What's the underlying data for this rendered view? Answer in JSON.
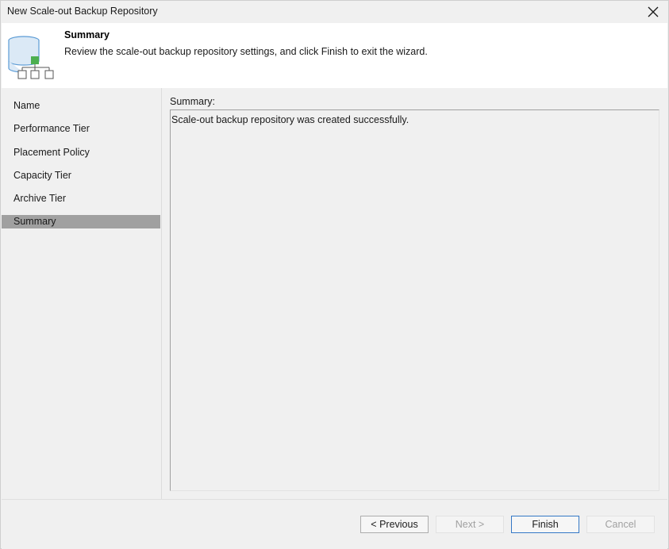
{
  "window": {
    "title": "New Scale-out Backup Repository"
  },
  "header": {
    "title": "Summary",
    "description": "Review the scale-out backup repository settings, and click Finish to exit the wizard.",
    "icon": "scale-out-repository-icon"
  },
  "nav": {
    "items": [
      {
        "label": "Name",
        "active": false
      },
      {
        "label": "Performance Tier",
        "active": false
      },
      {
        "label": "Placement Policy",
        "active": false
      },
      {
        "label": "Capacity Tier",
        "active": false
      },
      {
        "label": "Archive Tier",
        "active": false
      },
      {
        "label": "Summary",
        "active": true
      }
    ]
  },
  "content": {
    "summary_label": "Summary:",
    "summary_text": "Scale-out backup repository was created successfully."
  },
  "footer": {
    "previous_label": "< Previous",
    "next_label": "Next >",
    "finish_label": "Finish",
    "cancel_label": "Cancel"
  },
  "colors": {
    "active_nav": "#a0a0a0",
    "accent_green": "#4caf50",
    "icon_blue": "#5b9bd5",
    "default_button_border": "#3478c6"
  }
}
